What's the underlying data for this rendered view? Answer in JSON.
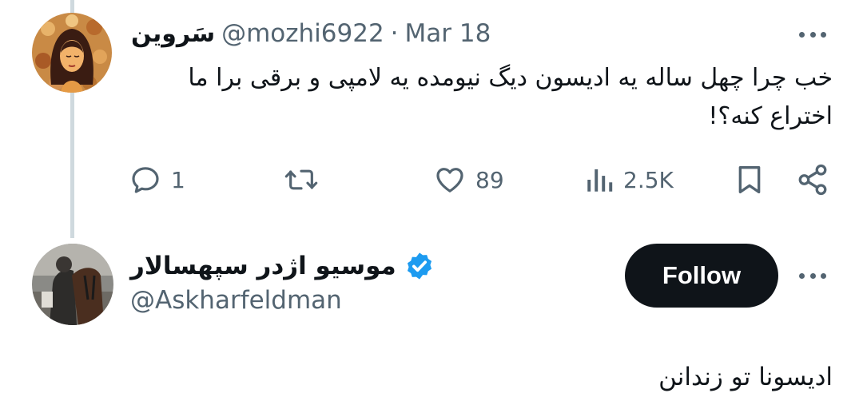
{
  "tweet1": {
    "display_name": "سَروین",
    "handle": "@mozhi6922",
    "separator": "·",
    "date": "Mar 18",
    "text": "خب چرا چهل ساله یه ادیسون دیگ نیومده یه لامپی و برقی برا ما اختراع کنه؟!",
    "more_icon": "more-horizontal-icon",
    "actions": {
      "reply_count": "1",
      "retweet_count": "",
      "like_count": "89",
      "views_count": "2.5K"
    }
  },
  "tweet2": {
    "display_name": "موسیو اژدر سپهسالار",
    "verified": true,
    "handle": "@Askharfeldman",
    "follow_label": "Follow",
    "text": "ادیسونا تو زندانن",
    "more_icon": "more-horizontal-icon"
  },
  "colors": {
    "text_primary": "#0f1419",
    "text_secondary": "#536471",
    "verified_blue": "#1d9bf0",
    "thread_line": "#cfd9de",
    "follow_bg": "#0f1419"
  }
}
